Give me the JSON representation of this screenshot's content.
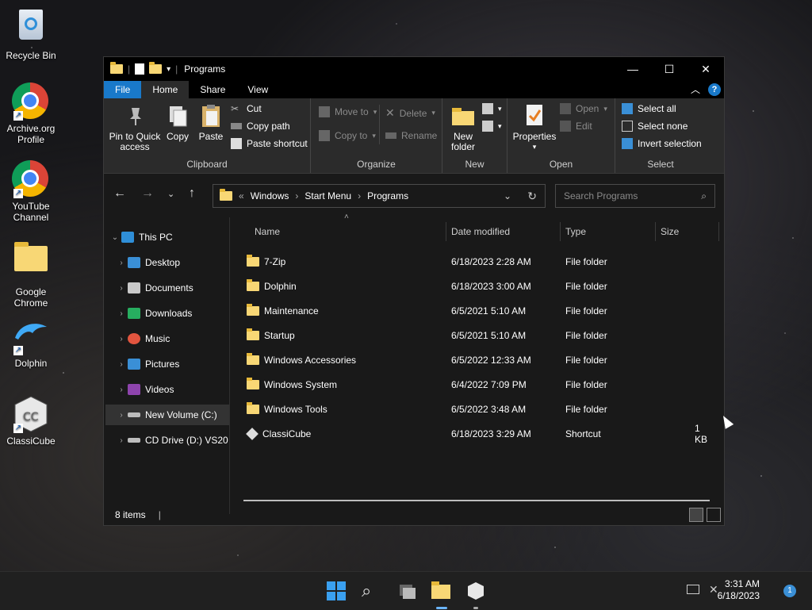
{
  "desktop": {
    "icons": [
      {
        "label": "Recycle Bin"
      },
      {
        "label": "Archive.org Profile"
      },
      {
        "label": "YouTube Channel"
      },
      {
        "label": "Google Chrome"
      },
      {
        "label": "Dolphin"
      },
      {
        "label": "ClassiCube"
      }
    ]
  },
  "window": {
    "title": "Programs",
    "controls": {
      "minimize": "—",
      "maximize": "☐",
      "close": "✕"
    },
    "tabs": [
      "File",
      "Home",
      "Share",
      "View"
    ],
    "help": "?",
    "ribbon": {
      "clipboard": {
        "label": "Clipboard",
        "pin": "Pin to Quick access",
        "copy": "Copy",
        "paste": "Paste",
        "cut": "Cut",
        "copy_path": "Copy path",
        "paste_shortcut": "Paste shortcut"
      },
      "organize": {
        "label": "Organize",
        "move_to": "Move to",
        "copy_to": "Copy to",
        "delete": "Delete",
        "rename": "Rename"
      },
      "new": {
        "label": "New",
        "new_folder": "New folder"
      },
      "open": {
        "label": "Open",
        "properties": "Properties",
        "open": "Open",
        "edit": "Edit"
      },
      "select": {
        "label": "Select",
        "select_all": "Select all",
        "select_none": "Select none",
        "invert": "Invert selection"
      }
    },
    "address": {
      "prefix": "«",
      "crumbs": [
        "Windows",
        "Start Menu",
        "Programs"
      ]
    },
    "search": {
      "placeholder": "Search Programs"
    },
    "nav": [
      {
        "label": "This PC",
        "icon": "monitor-icon",
        "color": "#2f8fd8"
      },
      {
        "label": "Desktop",
        "icon": "desktop-icon",
        "color": "#3a8fd6"
      },
      {
        "label": "Documents",
        "icon": "documents-icon",
        "color": "#c9c9c9"
      },
      {
        "label": "Downloads",
        "icon": "downloads-icon",
        "color": "#27ae60"
      },
      {
        "label": "Music",
        "icon": "music-icon",
        "color": "#e2553f"
      },
      {
        "label": "Pictures",
        "icon": "pictures-icon",
        "color": "#3a8fd6"
      },
      {
        "label": "Videos",
        "icon": "videos-icon",
        "color": "#8e44ad"
      },
      {
        "label": "New Volume (C:)",
        "icon": "drive-icon",
        "color": "#bdbdbd"
      },
      {
        "label": "CD Drive (D:) VS20",
        "icon": "cd-drive-icon",
        "color": "#bdbdbd"
      }
    ],
    "columns": [
      "Name",
      "Date modified",
      "Type",
      "Size"
    ],
    "files": [
      {
        "name": "7-Zip",
        "date": "6/18/2023 2:28 AM",
        "type": "File folder",
        "size": ""
      },
      {
        "name": "Dolphin",
        "date": "6/18/2023 3:00 AM",
        "type": "File folder",
        "size": ""
      },
      {
        "name": "Maintenance",
        "date": "6/5/2021 5:10 AM",
        "type": "File folder",
        "size": ""
      },
      {
        "name": "Startup",
        "date": "6/5/2021 5:10 AM",
        "type": "File folder",
        "size": ""
      },
      {
        "name": "Windows Accessories",
        "date": "6/5/2022 12:33 AM",
        "type": "File folder",
        "size": ""
      },
      {
        "name": "Windows System",
        "date": "6/4/2022 7:09 PM",
        "type": "File folder",
        "size": ""
      },
      {
        "name": "Windows Tools",
        "date": "6/5/2022 3:48 AM",
        "type": "File folder",
        "size": ""
      },
      {
        "name": "ClassiCube",
        "date": "6/18/2023 3:29 AM",
        "type": "Shortcut",
        "size": "1 KB"
      }
    ],
    "status": "8 items"
  },
  "taskbar": {
    "time": "3:31 AM",
    "date": "6/18/2023",
    "notifications": "1"
  }
}
